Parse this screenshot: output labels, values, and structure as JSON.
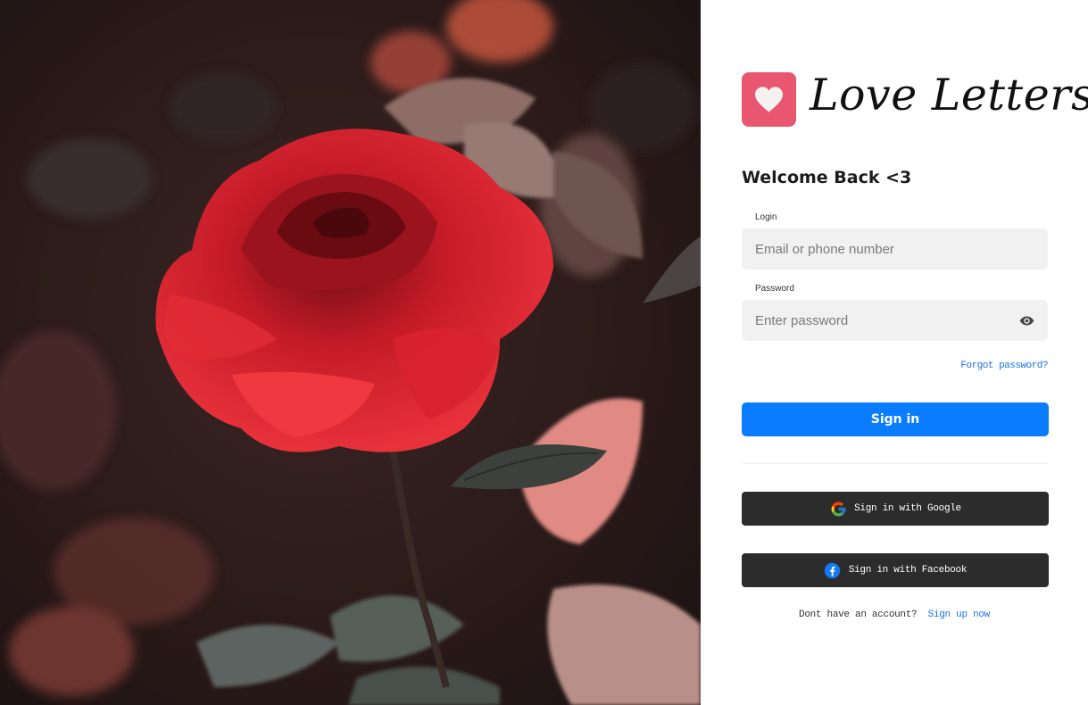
{
  "photo": {
    "alt": "Red rose among leaves"
  },
  "brand": {
    "logo_icon": "heart-icon",
    "name": "Love Letters",
    "accent": "#e8566f"
  },
  "login": {
    "heading": "Welcome Back <3",
    "login_label": "Login",
    "login_placeholder": "Email or phone number",
    "password_label": "Password",
    "password_placeholder": "Enter password",
    "password_toggle_icon": "eye-icon",
    "forgot_link": "Forgot password?",
    "signin_label": "Sign in",
    "signin_color": "#0a7cff",
    "google_label": "Sign in with Google",
    "facebook_label": "Sign in with Facebook",
    "no_account_text": "Dont have an account?",
    "signup_link": "Sign up now"
  }
}
